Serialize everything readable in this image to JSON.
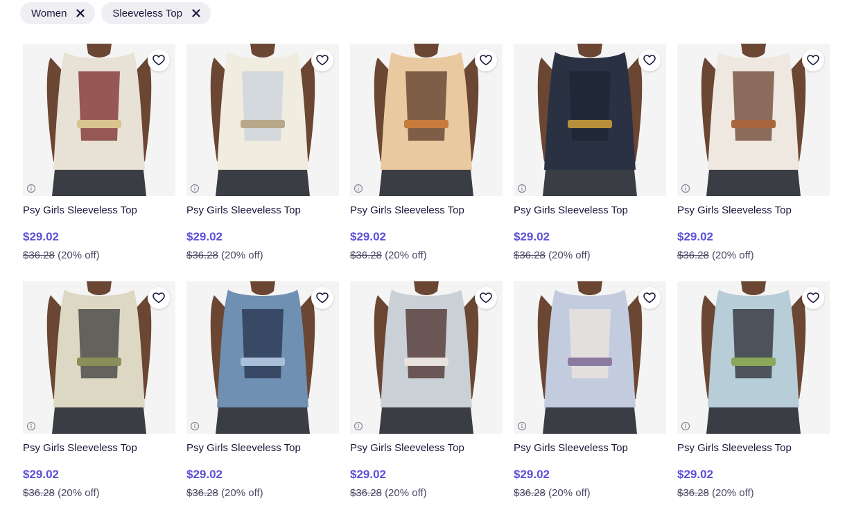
{
  "filters": [
    {
      "label": "Women"
    },
    {
      "label": "Sleeveless Top"
    }
  ],
  "products": [
    {
      "title": "Psy Girls Sleeveless Top",
      "price": "$29.02",
      "original_price": "$36.28",
      "discount": "(20% off)",
      "colors": [
        "#e8e2d6",
        "#7a2a2a",
        "#d9c48f"
      ]
    },
    {
      "title": "Psy Girls Sleeveless Top",
      "price": "$29.02",
      "original_price": "$36.28",
      "discount": "(20% off)",
      "colors": [
        "#f0ece0",
        "#c9d3db",
        "#b9a98a"
      ]
    },
    {
      "title": "Psy Girls Sleeveless Top",
      "price": "$29.02",
      "original_price": "$36.28",
      "discount": "(20% off)",
      "colors": [
        "#e9c9a0",
        "#5a3a2a",
        "#c77a3c"
      ]
    },
    {
      "title": "Psy Girls Sleeveless Top",
      "price": "$29.02",
      "original_price": "$36.28",
      "discount": "(20% off)",
      "colors": [
        "#2a3142",
        "#1e2433",
        "#b8903c"
      ]
    },
    {
      "title": "Psy Girls Sleeveless Top",
      "price": "$29.02",
      "original_price": "$36.28",
      "discount": "(20% off)",
      "colors": [
        "#efe8e0",
        "#6a4230",
        "#a8663c"
      ]
    },
    {
      "title": "Psy Girls Sleeveless Top",
      "price": "$29.02",
      "original_price": "$36.28",
      "discount": "(20% off)",
      "colors": [
        "#ddd8c4",
        "#3a3b3a",
        "#8a8f5a"
      ]
    },
    {
      "title": "Psy Girls Sleeveless Top",
      "price": "$29.02",
      "original_price": "$36.28",
      "discount": "(20% off)",
      "colors": [
        "#6f8fb3",
        "#24324a",
        "#aac0d8"
      ]
    },
    {
      "title": "Psy Girls Sleeveless Top",
      "price": "$29.02",
      "original_price": "$36.28",
      "discount": "(20% off)",
      "colors": [
        "#c9d0d6",
        "#4a2e28",
        "#e8e2dc"
      ]
    },
    {
      "title": "Psy Girls Sleeveless Top",
      "price": "$29.02",
      "original_price": "$36.28",
      "discount": "(20% off)",
      "colors": [
        "#c3ccdf",
        "#ede5dd",
        "#8a7aa0"
      ]
    },
    {
      "title": "Psy Girls Sleeveless Top",
      "price": "$29.02",
      "original_price": "$36.28",
      "discount": "(20% off)",
      "colors": [
        "#b7cdd8",
        "#2a2a30",
        "#8aa75a"
      ]
    }
  ]
}
